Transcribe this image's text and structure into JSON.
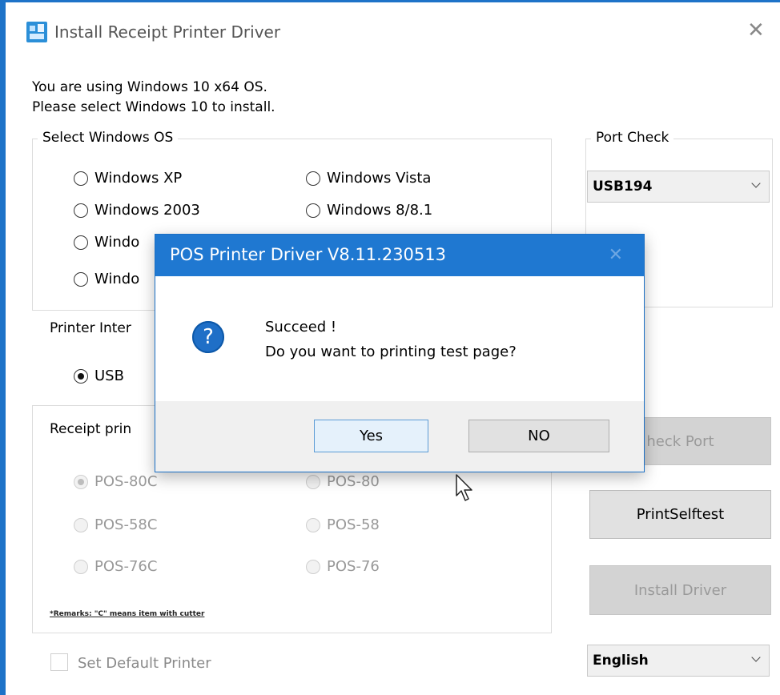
{
  "window": {
    "title": "Install Receipt Printer Driver",
    "info_line1": "You are using Windows 10 x64 OS.",
    "info_line2": "Please select Windows 10 to install."
  },
  "os_group": {
    "label": "Select Windows OS",
    "options": [
      "Windows XP",
      "Windows Vista",
      "Windows 2003",
      "Windows 8/8.1",
      "Windo",
      "Windo"
    ]
  },
  "port_check": {
    "label": "Port Check",
    "selected": "USB194"
  },
  "interface_group": {
    "label": "Printer Inter",
    "selected_option": "USB"
  },
  "receipt_group": {
    "label": "Receipt prin",
    "options": [
      "POS-80C",
      "POS-80",
      "POS-58C",
      "POS-58",
      "POS-76C",
      "POS-76"
    ],
    "remark": "*Remarks: \"C\" means item with cutter"
  },
  "buttons": {
    "check_port": "heck Port",
    "print_selftest": "PrintSelftest",
    "install_driver": "Install Driver"
  },
  "set_default": "Set Default Printer",
  "language": {
    "selected": "English"
  },
  "dialog": {
    "title": "POS Printer Driver V8.11.230513",
    "message_line1": "Succeed !",
    "message_line2": "Do you want to printing test page?",
    "yes_label": "Yes",
    "no_label": "NO",
    "icon_glyph": "?"
  },
  "colors": {
    "accent": "#1f78d1",
    "window_border": "#1e73c8"
  }
}
